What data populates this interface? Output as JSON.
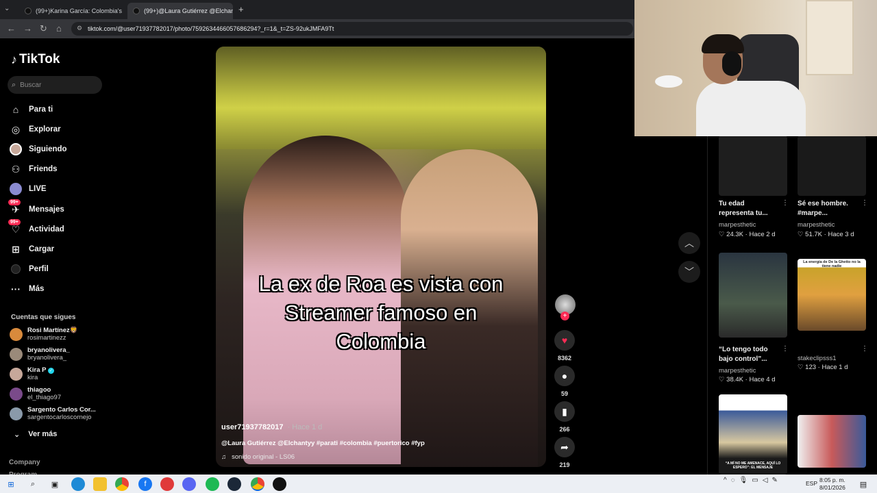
{
  "browser": {
    "tabs": [
      {
        "label": "(99+)Karina García: Colombia's",
        "active": false
      },
      {
        "label": "(99+)@Laura Gutiérrez @Elchan",
        "active": true
      }
    ],
    "new_tab_icon": "plus-icon",
    "url": "tiktok.com/@user71937782017/photo/7592634466057686294?_r=1&_t=ZS-92ukJMFA9Tt"
  },
  "sidebar": {
    "logo": "TikTok",
    "search_placeholder": "Buscar",
    "nav": [
      {
        "label": "Para ti",
        "icon": "home-icon"
      },
      {
        "label": "Explorar",
        "icon": "compass-icon"
      },
      {
        "label": "Siguiendo",
        "icon": "following-avatar-icon"
      },
      {
        "label": "Friends",
        "icon": "friends-icon"
      },
      {
        "label": "LIVE",
        "icon": "live-icon"
      },
      {
        "label": "Mensajes",
        "icon": "messages-icon",
        "badge": "99+"
      },
      {
        "label": "Actividad",
        "icon": "activity-icon",
        "badge": "99+"
      },
      {
        "label": "Cargar",
        "icon": "upload-icon"
      },
      {
        "label": "Perfil",
        "icon": "profile-icon"
      },
      {
        "label": "Más",
        "icon": "more-icon"
      }
    ],
    "following_title": "Cuentas que sigues",
    "accounts": [
      {
        "name": "Rosi Martínez🦁",
        "handle": "rosimartinezz",
        "color": "#d88a3c"
      },
      {
        "name": "bryanolivera_",
        "handle": "bryanolivera_",
        "color": "#9a8a7a"
      },
      {
        "name": "Kira P",
        "handle": "kira",
        "color": "#c7a89a",
        "verified": true
      },
      {
        "name": "thiagoo",
        "handle": "el_thiago97",
        "color": "#7a4a8a"
      },
      {
        "name": "Sargento Carlos Cor...",
        "handle": "sargentocarloscornejo",
        "color": "#8a9aaa"
      }
    ],
    "see_more": "Ver más",
    "footer": {
      "company": "Company",
      "program": "Program"
    }
  },
  "post": {
    "caption_lines": [
      "La ex de Roa es vista con",
      "Streamer famoso en",
      "Colombia"
    ],
    "username": "user71937782017",
    "time": "· Hace 1 d",
    "description": "@Laura Gutiérrez @Elchantyy #parati #colombia #puertorico #fyp",
    "sound": "sonido original - LS06",
    "likes": "8362",
    "comments": "59",
    "saves": "266",
    "shares": "219"
  },
  "related": [
    {
      "title": "Tu edad representa tu...",
      "author": "marpesthetic",
      "likes": "24.3K",
      "time": "Hace 2 d",
      "color": "#1e1e1e"
    },
    {
      "title": "Sé ese hombre. #marpe...",
      "author": "marpesthetic",
      "likes": "51.7K",
      "time": "Hace 3 d",
      "color": "#1a1a1a"
    },
    {
      "title": "“Lo tengo todo bajo control”...",
      "author": "marpesthetic",
      "likes": "38.4K",
      "time": "Hace 4 d",
      "color": "#2a3540",
      "overlay": ""
    },
    {
      "title": "",
      "author": "stakeclipsss1",
      "likes": "123",
      "time": "Hace 1 d",
      "color": "#c9a32a",
      "overlay": "La energía de De la Ghetto no la tiene nadie"
    },
    {
      "title": "",
      "author": "",
      "likes": "",
      "time": "",
      "color": "#3a5a9a",
      "overlay": "“A MÍ NO ME AMENACE, AQUÍ LO ESPERO”: EL MENSAJE"
    },
    {
      "title": "",
      "author": "",
      "likes": "",
      "time": "",
      "color": "#c85a5a",
      "overlay": ""
    }
  ],
  "taskbar": {
    "language": "ESP",
    "time": "8:05 p. m.",
    "date": "8/01/2026"
  }
}
